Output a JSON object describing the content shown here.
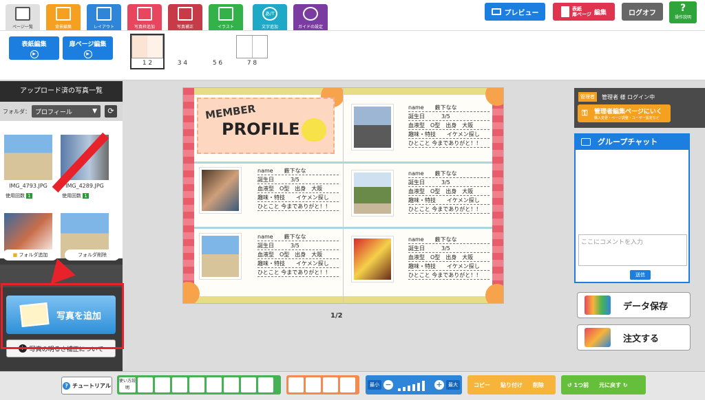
{
  "topbar": {
    "tools": [
      {
        "label": "ページ一覧"
      },
      {
        "label": "背景編集"
      },
      {
        "label": "レイアウト"
      },
      {
        "label": "写真枠追加"
      },
      {
        "label": "写真補正"
      },
      {
        "label": "イラスト"
      },
      {
        "label": "文字追加"
      },
      {
        "label": "ガイドの設定"
      }
    ],
    "preview_label": "プレビュー",
    "cover_edit_label_1": "表紙",
    "cover_edit_label_2": "扉ページ",
    "cover_edit_label_3": "編集",
    "logoff_label": "ログオフ",
    "help_label": "操作説明",
    "text_tool_glyph": "あ/T"
  },
  "subbar": {
    "cover_edit": "表紙編集",
    "door_edit": "扉ページ編集",
    "spread_labels": [
      "1 2",
      "3 4",
      "5 6",
      "7 8"
    ]
  },
  "leftpanel": {
    "title": "アップロード済の写真一覧",
    "folder_label": "フォルダ：",
    "folder_value": "プロフィール",
    "photos": [
      {
        "name": "IMG_4793.JPG",
        "usage": "使用回数",
        "count": "1"
      },
      {
        "name": "IMG_4289.JPG",
        "usage": "使用回数",
        "count": "1"
      }
    ],
    "folder_add": "フォルダ追加",
    "folder_delete": "フォルダ削除",
    "add_photo": "写真を追加",
    "brightness": "写真の明るさ補正について"
  },
  "spread": {
    "title_member": "MEMBER",
    "title_profile": "PROFILE",
    "profiles": [
      {
        "name": "name　　薮下なな",
        "birthday": "誕生日　　　3/5",
        "blood": "血液型　O型　出身　大阪",
        "hobby": "趣味・特技　　イケメン探し",
        "comment": "ひとこと 今までありがと！！"
      },
      {
        "name": "name　　薮下なな",
        "birthday": "誕生日　　　3/5",
        "blood": "血液型　O型　出身　大阪",
        "hobby": "趣味・特技　　イケメン探し",
        "comment": "ひとこと 今までありがと！！"
      },
      {
        "name": "name　　薮下なな",
        "birthday": "誕生日　　　3/5",
        "blood": "血液型　O型　出身　大阪",
        "hobby": "趣味・特技　　イケメン探し",
        "comment": "ひとこと 今までありがと！！"
      },
      {
        "name": "name　　薮下なな",
        "birthday": "誕生日　　　3/5",
        "blood": "血液型　O型　出身　大阪",
        "hobby": "趣味・特技　　イケメン探し",
        "comment": "ひとこと 今までありがと！！"
      },
      {
        "name": "name　　薮下なな",
        "birthday": "誕生日　　　3/5",
        "blood": "血液型　O型　出身　大阪",
        "hobby": "趣味・特技　　イケメン探し",
        "comment": "ひとこと 今までありがと！！"
      }
    ],
    "page_indicator": "1/2"
  },
  "rightpanel": {
    "admin_badge": "管理者",
    "login_text": "管理者 様 ログイン中",
    "admin_page": "管理者編集ページにいく",
    "admin_page_sub": "購入変更・ページ調整・ユーザー設定など",
    "chat_title": "グループチャット",
    "chat_placeholder": "ここにコメントを入力",
    "send": "送信",
    "save": "データ保存",
    "order": "注文する"
  },
  "bottombar": {
    "tutorial": "チュートリアル",
    "usage": "使い方説明",
    "zoom_min": "最小",
    "zoom_max": "最大",
    "copy": "コピー",
    "paste": "貼り付け",
    "delete": "削除",
    "undo": "1つ前",
    "redo": "元に戻す"
  },
  "colors": {
    "accent": "#1c7fe0",
    "highlight": "#e8222a",
    "admin": "#f4a020"
  }
}
